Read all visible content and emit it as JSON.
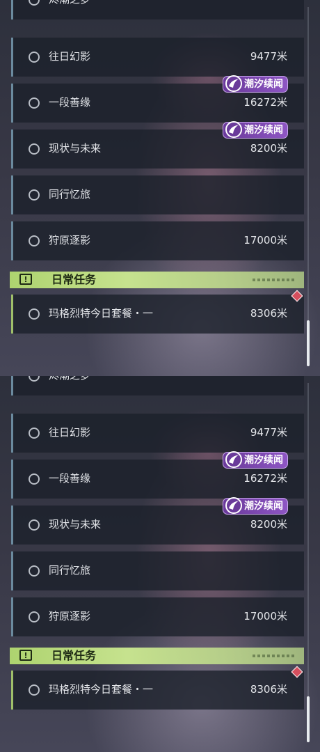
{
  "colors": {
    "quest_bar": "#6b8a9e",
    "daily_accent": "#9fbf6a",
    "daily_header": "#b5d77a",
    "badge_purple": "#7e4ab4",
    "notify_red": "#d54f5e"
  },
  "quests": [
    {
      "name": "烬潮之梦",
      "distance": ""
    },
    {
      "name": "往日幻影",
      "distance": "9477米"
    },
    {
      "name": "一段善缘",
      "distance": "16272米",
      "badge": "潮汐续闻"
    },
    {
      "name": "现状与未来",
      "distance": "8200米",
      "badge": "潮汐续闻"
    },
    {
      "name": "同行忆旅",
      "distance": ""
    },
    {
      "name": "狩原逐影",
      "distance": "17000米"
    }
  ],
  "daily": {
    "header": "日常任务",
    "header_icon": "exclamation-icon",
    "quest": {
      "name": "玛格烈特今日套餐・一",
      "distance": "8306米"
    }
  }
}
